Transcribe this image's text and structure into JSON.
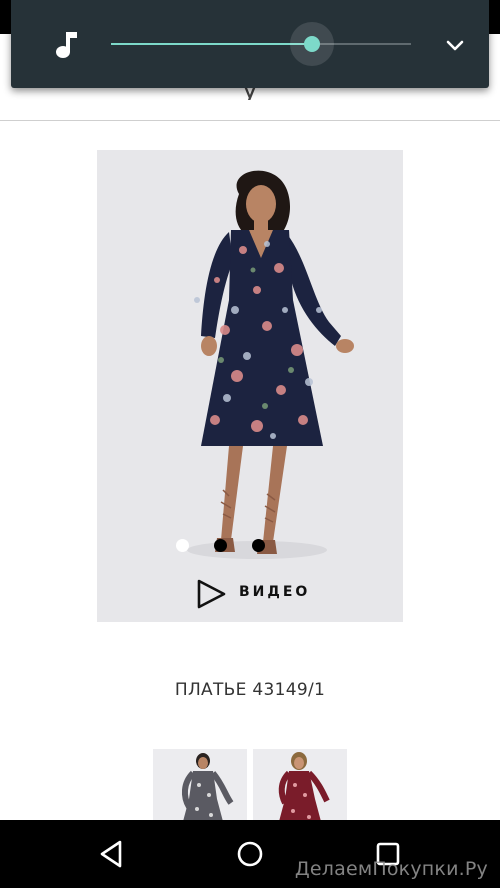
{
  "header": {
    "partial_text": "у"
  },
  "volume": {
    "icon": "music-note-icon",
    "level_percent": 67,
    "expand_icon": "chevron-down-icon",
    "accent": "#7dd9c9"
  },
  "product": {
    "photo": "floral-dress-model",
    "carousel": {
      "count": 3,
      "active_index": 0
    },
    "video_label": "ВИДЕО",
    "title": "ПЛАТЬЕ 43149/1"
  },
  "thumbnails": [
    {
      "name": "thumbnail-grey-floral-dress"
    },
    {
      "name": "thumbnail-burgundy-floral-dress"
    }
  ],
  "nav": {
    "back": "back-icon",
    "home": "home-icon",
    "recents": "recents-icon"
  },
  "watermark": "ДелаемПокупки.Ру"
}
